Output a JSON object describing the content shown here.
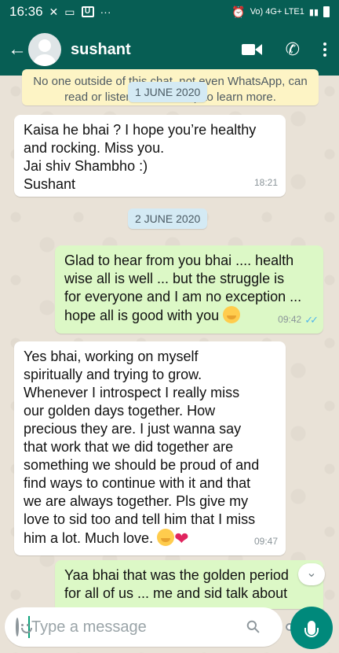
{
  "status_bar": {
    "time": "16:36",
    "network": "Vo) 4G+ LTE1"
  },
  "header": {
    "contact_name": "sushant"
  },
  "notice": {
    "text": "No one outside of this chat, not even WhatsApp, can read or listen to them. Tap to learn more."
  },
  "messages": [
    {
      "date_chip": "1 JUNE 2020"
    },
    {
      "direction": "in",
      "text": "Kaisa he bhai ? I hope you’re healthy\nand rocking. Miss you.\nJai shiv Shambho :)\nSushant",
      "time": "18:21"
    },
    {
      "date_chip": "2 JUNE 2020"
    },
    {
      "direction": "out",
      "text": "Glad to hear from you bhai .... health\nwise all is well ... but the struggle is\nfor everyone and I am no exception ...\nhope all is good with you",
      "time": "09:42"
    },
    {
      "direction": "in",
      "text": "Yes bhai, working on myself\nspiritually and trying to grow.\nWhenever I introspect I really miss\nour golden days together. How\nprecious they are.  I just wanna say\nthat work that we did together are\nsomething we should be proud of and\nfind ways to continue with it and that\nwe are always together. Pls give my\nlove to sid too and tell him that I miss\nhim a lot. Much love.",
      "time": "09:47"
    },
    {
      "direction": "out",
      "text": "Yaa bhai that was the golden period\nfor all of us ... me and sid talk about"
    }
  ],
  "input": {
    "placeholder": "Type a message"
  },
  "colors": {
    "header": "#075e54",
    "outgoing": "#dcf8c6",
    "incoming": "#ffffff",
    "accent": "#00897b"
  }
}
